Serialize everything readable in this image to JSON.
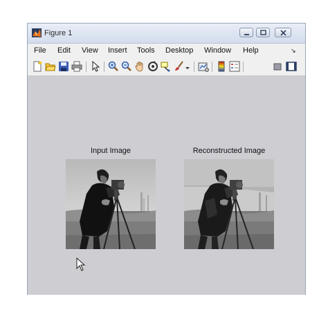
{
  "window": {
    "title": "Figure 1",
    "menu": [
      "File",
      "Edit",
      "View",
      "Insert",
      "Tools",
      "Desktop",
      "Window",
      "Help"
    ],
    "menu_overflow_glyph": "↘"
  },
  "toolbar": {
    "icons": [
      "new-figure-icon",
      "open-file-icon",
      "save-icon",
      "print-icon",
      "pointer-icon",
      "zoom-in-icon",
      "zoom-out-icon",
      "pan-icon",
      "rotate-3d-icon",
      "data-cursor-icon",
      "brush-icon",
      "link-plot-icon",
      "colorbar-icon",
      "legend-icon",
      "hide-plot-tools-icon",
      "show-plot-tools-icon"
    ]
  },
  "axes": [
    {
      "title": "Input Image"
    },
    {
      "title": "Reconstructed Image"
    }
  ],
  "colors": {
    "figure_bg": "#cdcdd2",
    "accent": "#e8741c"
  }
}
